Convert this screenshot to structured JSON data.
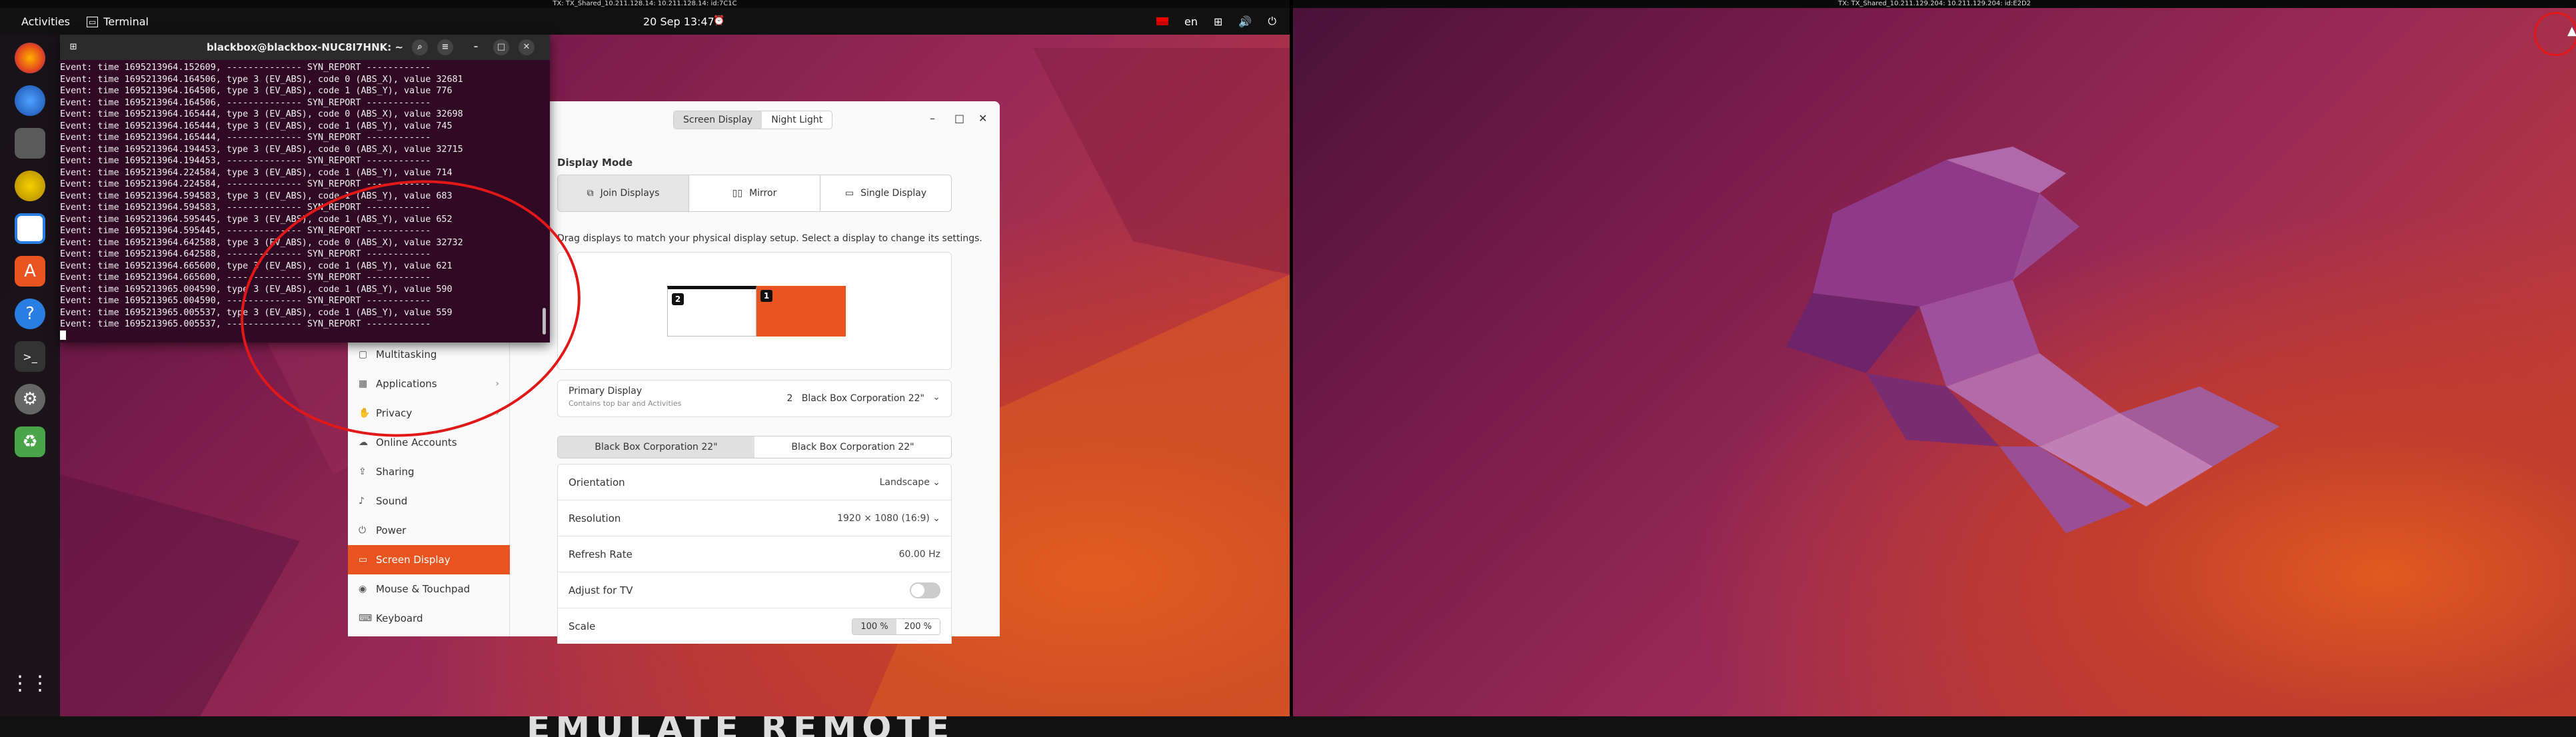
{
  "left_screen": {
    "tx_title": "TX: TX_Shared_10.211.128.14: 10.211.128.14: id:7C1C",
    "topbar": {
      "activities": "Activities",
      "app_name": "Terminal",
      "clock": "20 Sep  13:47",
      "lang": "en"
    },
    "terminal": {
      "title": "blackbox@blackbox-NUC8I7HNK: ~",
      "lines": [
        "Event: time 1695213964.152609, -------------- SYN_REPORT ------------",
        "Event: time 1695213964.164506, type 3 (EV_ABS), code 0 (ABS_X), value 32681",
        "Event: time 1695213964.164506, type 3 (EV_ABS), code 1 (ABS_Y), value 776",
        "Event: time 1695213964.164506, -------------- SYN_REPORT ------------",
        "Event: time 1695213964.165444, type 3 (EV_ABS), code 0 (ABS_X), value 32698",
        "Event: time 1695213964.165444, type 3 (EV_ABS), code 1 (ABS_Y), value 745",
        "Event: time 1695213964.165444, -------------- SYN_REPORT ------------",
        "Event: time 1695213964.194453, type 3 (EV_ABS), code 0 (ABS_X), value 32715",
        "Event: time 1695213964.194453, -------------- SYN_REPORT ------------",
        "Event: time 1695213964.224584, type 3 (EV_ABS), code 1 (ABS_Y), value 714",
        "Event: time 1695213964.224584, -------------- SYN_REPORT ------------",
        "Event: time 1695213964.594583, type 3 (EV_ABS), code 1 (ABS_Y), value 683",
        "Event: time 1695213964.594583, -------------- SYN_REPORT ------------",
        "Event: time 1695213964.595445, type 3 (EV_ABS), code 1 (ABS_Y), value 652",
        "Event: time 1695213964.595445, -------------- SYN_REPORT ------------",
        "Event: time 1695213964.642588, type 3 (EV_ABS), code 0 (ABS_X), value 32732",
        "Event: time 1695213964.642588, -------------- SYN_REPORT ------------",
        "Event: time 1695213964.665600, type 3 (EV_ABS), code 1 (ABS_Y), value 621",
        "Event: time 1695213964.665600, -------------- SYN_REPORT ------------",
        "Event: time 1695213965.004590, type 3 (EV_ABS), code 1 (ABS_Y), value 590",
        "Event: time 1695213965.004590, -------------- SYN_REPORT ------------",
        "Event: time 1695213965.005537, type 3 (EV_ABS), code 1 (ABS_Y), value 559",
        "Event: time 1695213965.005537, -------------- SYN_REPORT ------------"
      ]
    },
    "settings": {
      "tabs": [
        "Screen Display",
        "Night Light"
      ],
      "active_tab": "Screen Display",
      "sidebar": [
        {
          "label": "Multitasking",
          "icon": "multitasking-icon",
          "chevron": false
        },
        {
          "label": "Applications",
          "icon": "apps-icon",
          "chevron": true
        },
        {
          "label": "Privacy",
          "icon": "privacy-icon",
          "chevron": true
        },
        {
          "label": "Online Accounts",
          "icon": "cloud-icon",
          "chevron": false
        },
        {
          "label": "Sharing",
          "icon": "share-icon",
          "chevron": false
        },
        {
          "label": "Sound",
          "icon": "sound-icon",
          "chevron": false
        },
        {
          "label": "Power",
          "icon": "power-icon",
          "chevron": false
        },
        {
          "label": "Screen Display",
          "icon": "display-icon",
          "chevron": false,
          "active": true
        },
        {
          "label": "Mouse & Touchpad",
          "icon": "mouse-icon",
          "chevron": false
        },
        {
          "label": "Keyboard",
          "icon": "keyboard-icon",
          "chevron": false
        }
      ],
      "display_mode_label": "Display Mode",
      "display_modes": [
        "Join Displays",
        "Mirror",
        "Single Display"
      ],
      "active_mode": "Join Displays",
      "hint": "Drag displays to match your physical display setup. Select a display to change its settings.",
      "monitor_numbers": [
        "2",
        "1"
      ],
      "primary_display": {
        "label": "Primary Display",
        "sublabel": "Contains top bar and Activities",
        "value": "2   Black Box Corporation 22\""
      },
      "monitor_tabs": [
        "Black Box Corporation 22\"",
        "Black Box Corporation 22\""
      ],
      "rows": [
        {
          "label": "Orientation",
          "value": "Landscape",
          "dropdown": true
        },
        {
          "label": "Resolution",
          "value": "1920 × 1080 (16:9)",
          "dropdown": true
        },
        {
          "label": "Refresh Rate",
          "value": "60.00 Hz",
          "dropdown": false
        },
        {
          "label": "Adjust for TV",
          "value": "",
          "toggle": true
        },
        {
          "label": "Scale",
          "scales": [
            "100 %",
            "200 %"
          ]
        }
      ]
    }
  },
  "right_screen": {
    "tx_title": "TX: TX_Shared_10.211.129.204: 10.211.129.204: id:E2D2"
  },
  "bottom_text": "EMULATE REMOTE"
}
